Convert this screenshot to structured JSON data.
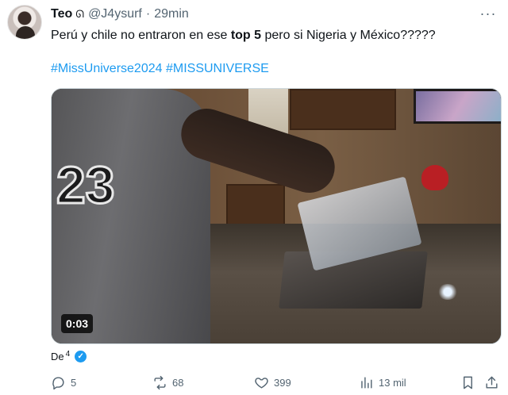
{
  "tweet": {
    "author_name": "Teo",
    "author_emoji": "ᘏ",
    "handle": "@J4ysurf",
    "separator": "·",
    "time": "29min",
    "more_label": "···",
    "text_before": "Perú y chile no entraron en ese ",
    "text_bold": "top 5",
    "text_after": " pero si Nigeria y México?????",
    "hashtag_1": "#MissUniverse2024",
    "hashtag_2": "#MISSUNIVERSE",
    "video_duration": "0:03",
    "video_jersey_number": "23",
    "from_label": "De",
    "from_superscript": "4",
    "verified_icon": "verified-check-icon"
  },
  "actions": {
    "replies": "5",
    "reposts": "68",
    "likes": "399",
    "views": "13 mil"
  },
  "colors": {
    "link": "#1d9bf0",
    "secondary_text": "#536471",
    "primary_text": "#0f1419"
  }
}
